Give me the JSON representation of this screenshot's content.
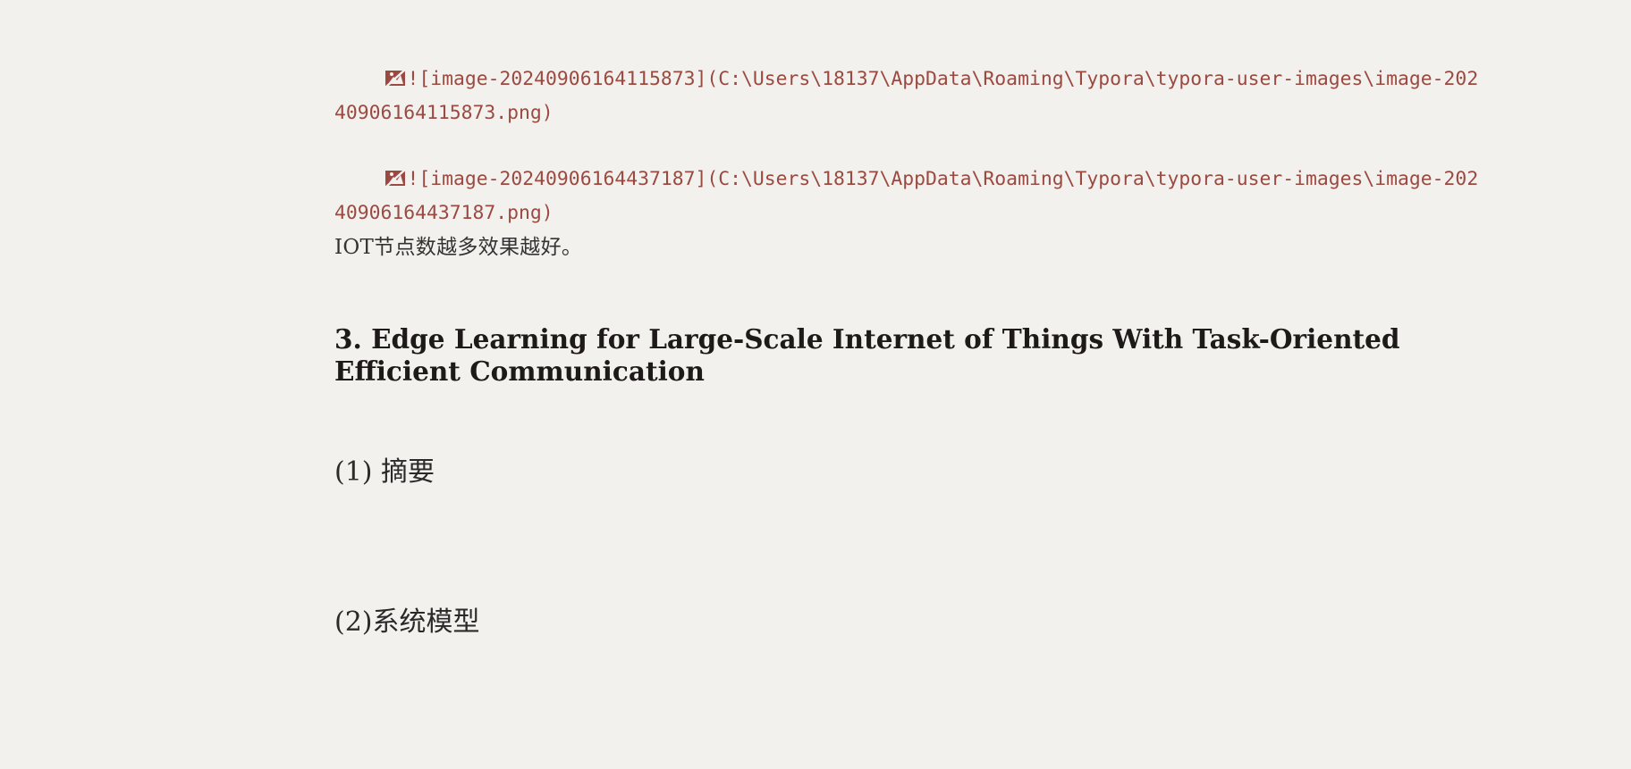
{
  "editor": {
    "image_refs": [
      {
        "icon": "broken-image-icon",
        "markdown": "![image-20240906164115873](C:\\Users\\18137\\AppData\\Roaming\\Typora\\typora-user-images\\image-20240906164115873.png)"
      },
      {
        "icon": "broken-image-icon",
        "markdown": "![image-20240906164437187](C:\\Users\\18137\\AppData\\Roaming\\Typora\\typora-user-images\\image-20240906164437187.png)"
      }
    ],
    "paragraph": "IOT节点数越多效果越好。",
    "heading": "3. Edge Learning for Large-Scale Internet of Things With Task-Oriented Efficient Communication",
    "subheading_1": "(1) 摘要",
    "subheading_2": "(2)系统模型"
  },
  "colors": {
    "background": "#f3f1ed",
    "link_text": "#9a4a41",
    "heading": "#1f1a1a"
  }
}
